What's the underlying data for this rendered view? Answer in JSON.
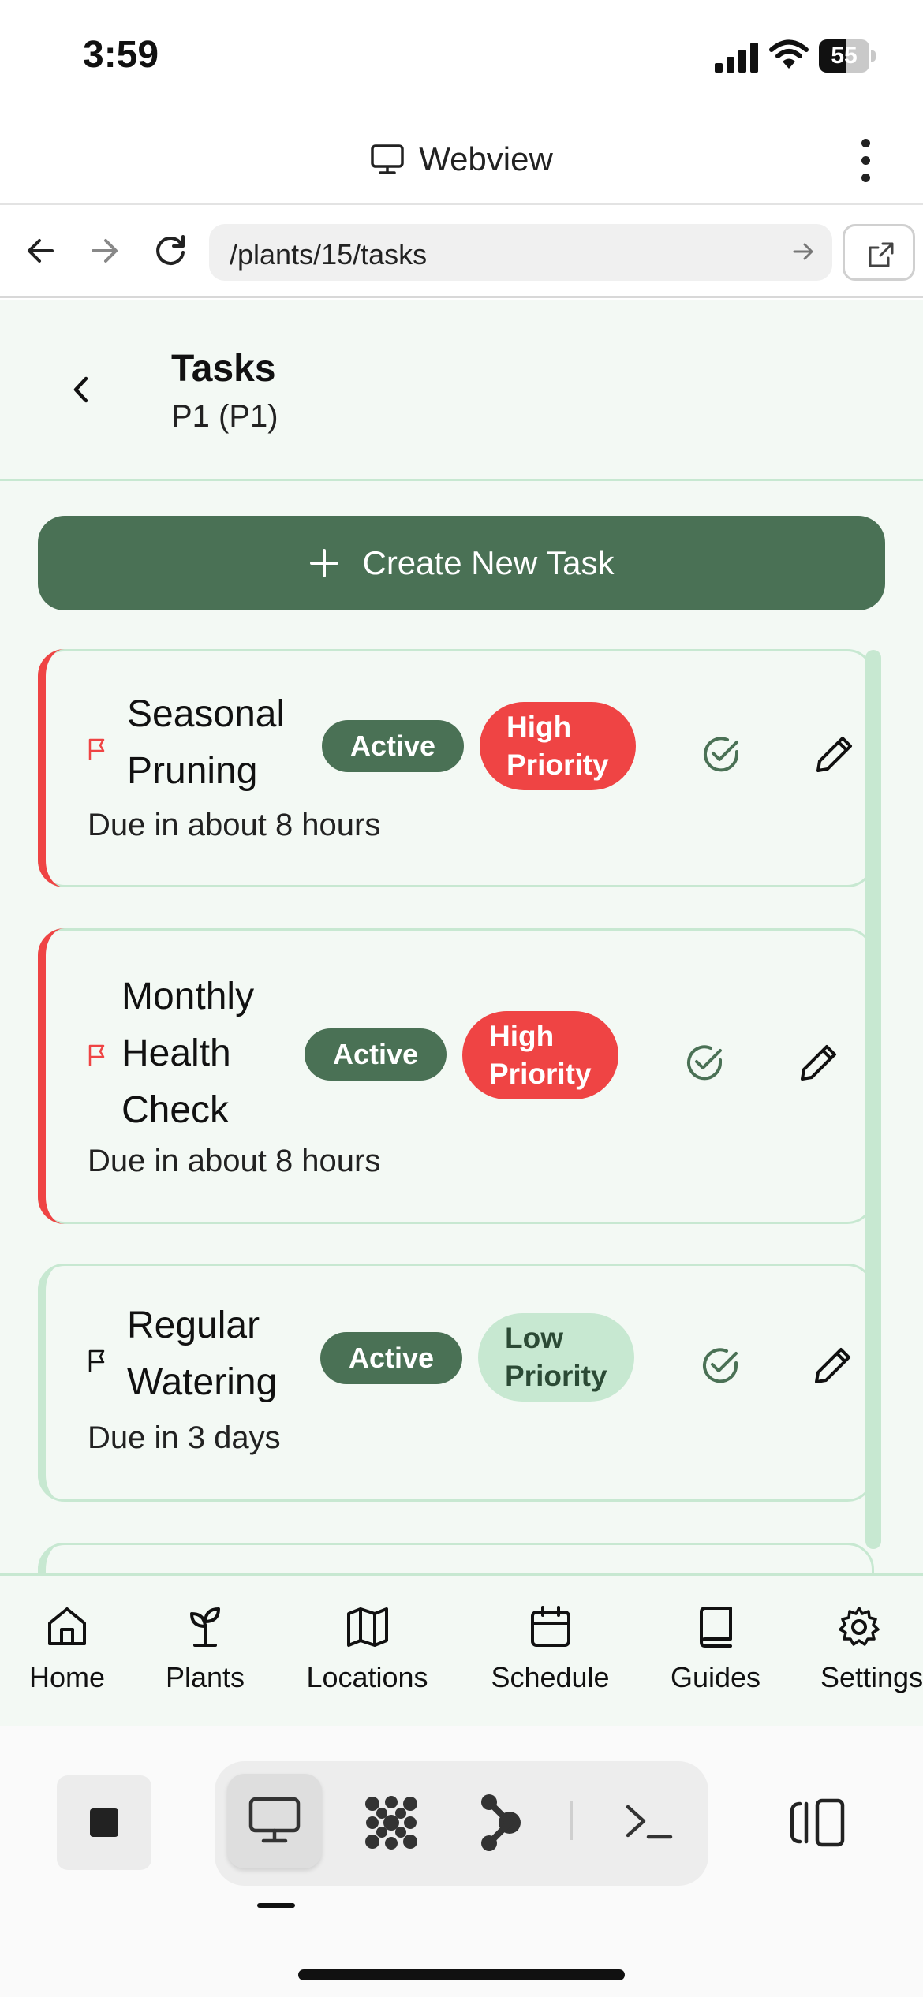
{
  "status_bar": {
    "time": "3:59",
    "battery": "55",
    "battery_level_percent": 55
  },
  "webview_header": {
    "title": "Webview",
    "icon": "monitor-icon",
    "menu_icon": "kebab-menu-icon"
  },
  "browser": {
    "url": "/plants/15/tasks"
  },
  "page": {
    "title": "Tasks",
    "subtitle": "P1 (P1)",
    "create_button": "Create New Task"
  },
  "tasks": [
    {
      "name_lines": [
        "Seasonal",
        "Pruning"
      ],
      "status": "Active",
      "priority_lines": [
        "High",
        "Priority"
      ],
      "priority": "high",
      "due": "Due in about 8 hours"
    },
    {
      "name_lines": [
        "Monthly",
        "Health",
        "Check"
      ],
      "status": "Active",
      "priority_lines": [
        "High",
        "Priority"
      ],
      "priority": "high",
      "due": "Due in about 8 hours"
    },
    {
      "name_lines": [
        "Regular",
        "Watering"
      ],
      "status": "Active",
      "priority_lines": [
        "Low",
        "Priority"
      ],
      "priority": "low",
      "due": "Due in 3 days"
    }
  ],
  "tabbar": {
    "items": [
      {
        "label": "Home",
        "icon": "home-icon"
      },
      {
        "label": "Plants",
        "icon": "sprout-icon"
      },
      {
        "label": "Locations",
        "icon": "map-icon"
      },
      {
        "label": "Schedule",
        "icon": "calendar-icon"
      },
      {
        "label": "Guides",
        "icon": "book-icon"
      },
      {
        "label": "Settings",
        "icon": "gear-icon"
      }
    ]
  },
  "colors": {
    "brand_green": "#4a7155",
    "mint_border": "#c7e8d1",
    "page_bg": "#f3f9f4",
    "high_priority": "#ef4444",
    "low_priority": "#c7e8d1"
  }
}
